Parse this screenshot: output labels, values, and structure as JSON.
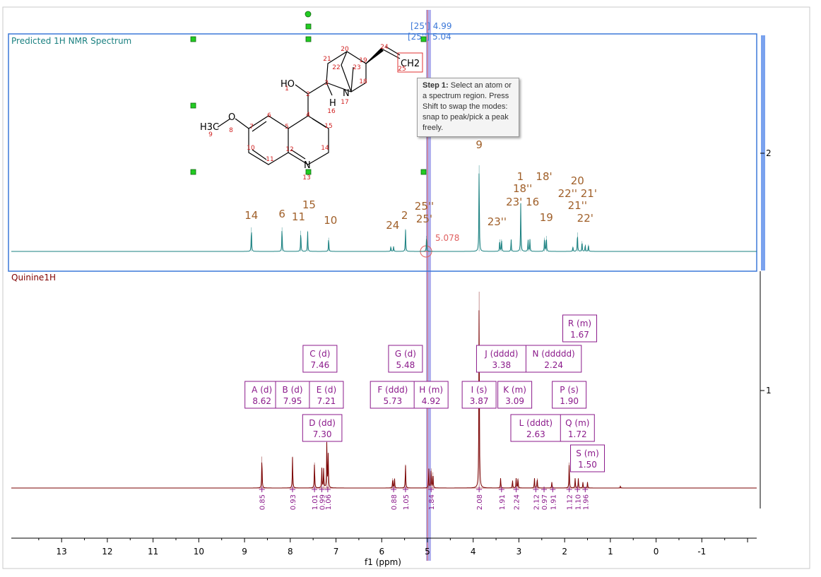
{
  "colors": {
    "predicted": "#1a8080",
    "experimental": "#7a0000",
    "peak_label": "#a0602a",
    "multiplet": "#8b1a8b",
    "selection": "#3c78d8",
    "cursor": "#e06060",
    "highlight_band": "#7070e0",
    "atom_number": "#d02020",
    "handle": "#22cc22"
  },
  "labels": {
    "predicted_title": "Predicted 1H NMR Spectrum",
    "experimental_title": "Quinine1H",
    "cursor_value": "5.078",
    "shift_label_1": "[25'] 4.99",
    "shift_label_2": "[25''] 5.04"
  },
  "tooltip": {
    "step": "Step 1:",
    "text": "Select an atom or a spectrum region. Press Shift to swap the modes: snap to peak/pick a peak freely."
  },
  "molecule": {
    "groups": [
      "HO",
      "H",
      "N",
      "N",
      "H3C",
      "O",
      "CH2"
    ],
    "atom_numbers": [
      "1",
      "2",
      "3",
      "4",
      "5",
      "6",
      "7",
      "8",
      "9",
      "10",
      "11",
      "12",
      "13",
      "14",
      "15",
      "16",
      "17",
      "18",
      "19",
      "20",
      "21",
      "22",
      "23",
      "24",
      "25"
    ]
  },
  "chart_data": {
    "type": "line",
    "xlabel": "f1 (ppm)",
    "xlim": [
      14.1,
      -2.2
    ],
    "x_reversed": true,
    "xticks": [
      13,
      12,
      11,
      10,
      9,
      8,
      7,
      6,
      5,
      4,
      3,
      2,
      1,
      0,
      -1
    ],
    "right_ticks": [
      "2",
      "1"
    ],
    "series": [
      {
        "name": "Predicted 1H NMR Spectrum",
        "peaks": [
          {
            "ppm": 8.85,
            "h": 0.28
          },
          {
            "ppm": 8.18,
            "h": 0.28
          },
          {
            "ppm": 7.77,
            "h": 0.24
          },
          {
            "ppm": 7.62,
            "h": 0.24
          },
          {
            "ppm": 7.16,
            "h": 0.16
          },
          {
            "ppm": 5.8,
            "h": 0.06
          },
          {
            "ppm": 5.74,
            "h": 0.06
          },
          {
            "ppm": 5.48,
            "h": 0.26
          },
          {
            "ppm": 5.02,
            "h": 0.18
          },
          {
            "ppm": 3.87,
            "h": 1.0
          },
          {
            "ppm": 3.42,
            "h": 0.14
          },
          {
            "ppm": 3.38,
            "h": 0.14
          },
          {
            "ppm": 3.17,
            "h": 0.14
          },
          {
            "ppm": 2.96,
            "h": 0.56
          },
          {
            "ppm": 2.8,
            "h": 0.14
          },
          {
            "ppm": 2.76,
            "h": 0.14
          },
          {
            "ppm": 2.44,
            "h": 0.16
          },
          {
            "ppm": 2.4,
            "h": 0.18
          },
          {
            "ppm": 1.82,
            "h": 0.06
          },
          {
            "ppm": 1.72,
            "h": 0.22
          },
          {
            "ppm": 1.62,
            "h": 0.12
          },
          {
            "ppm": 1.55,
            "h": 0.08
          },
          {
            "ppm": 1.48,
            "h": 0.08
          }
        ],
        "assignments": [
          {
            "ppm": 8.85,
            "lines": [
              "14"
            ]
          },
          {
            "ppm": 8.18,
            "lines": [
              "6"
            ]
          },
          {
            "ppm": 7.8,
            "lines": [
              "11"
            ]
          },
          {
            "ppm": 7.62,
            "lines": [
              "15"
            ]
          },
          {
            "ppm": 7.12,
            "lines": [
              "10"
            ]
          },
          {
            "ppm": 5.76,
            "lines": [
              "24"
            ]
          },
          {
            "ppm": 5.5,
            "lines": [
              "2"
            ]
          },
          {
            "ppm": 5.04,
            "lines": [
              "25''",
              "25'"
            ]
          },
          {
            "ppm": 3.87,
            "lines": [
              "9"
            ]
          },
          {
            "ppm": 3.48,
            "lines": [
              "23''"
            ]
          },
          {
            "ppm": 2.92,
            "lines": [
              "1",
              "18''",
              "23' 16"
            ]
          },
          {
            "ppm": 2.45,
            "lines": [
              "18'"
            ]
          },
          {
            "ppm": 2.42,
            "lines": [
              "19"
            ]
          },
          {
            "ppm": 1.72,
            "lines": [
              "20",
              "22'' 21'",
              "21''",
              "22'"
            ]
          }
        ]
      },
      {
        "name": "Quinine1H",
        "peaks": [
          {
            "ppm": 8.62,
            "h": 0.16
          },
          {
            "ppm": 7.95,
            "h": 0.16
          },
          {
            "ppm": 7.47,
            "h": 0.13
          },
          {
            "ppm": 7.31,
            "h": 0.1
          },
          {
            "ppm": 7.27,
            "h": 0.1
          },
          {
            "ppm": 7.2,
            "h": 0.24
          },
          {
            "ppm": 7.17,
            "h": 0.17
          },
          {
            "ppm": 5.76,
            "h": 0.05
          },
          {
            "ppm": 5.72,
            "h": 0.05
          },
          {
            "ppm": 5.48,
            "h": 0.12
          },
          {
            "ppm": 4.97,
            "h": 0.1
          },
          {
            "ppm": 4.92,
            "h": 0.1
          },
          {
            "ppm": 4.88,
            "h": 0.08
          },
          {
            "ppm": 3.87,
            "h": 1.0
          },
          {
            "ppm": 3.4,
            "h": 0.05
          },
          {
            "ppm": 3.14,
            "h": 0.04
          },
          {
            "ppm": 3.06,
            "h": 0.05
          },
          {
            "ppm": 3.02,
            "h": 0.05
          },
          {
            "ppm": 2.66,
            "h": 0.05
          },
          {
            "ppm": 2.6,
            "h": 0.05
          },
          {
            "ppm": 2.28,
            "h": 0.03
          },
          {
            "ppm": 1.9,
            "h": 0.13
          },
          {
            "ppm": 1.77,
            "h": 0.05
          },
          {
            "ppm": 1.7,
            "h": 0.05
          },
          {
            "ppm": 1.6,
            "h": 0.03
          },
          {
            "ppm": 1.5,
            "h": 0.03
          },
          {
            "ppm": 0.78,
            "h": 0.01
          }
        ],
        "multiplets": [
          {
            "label": "A (d)",
            "value": "8.62",
            "ppm": 8.62,
            "row": 2
          },
          {
            "label": "B (d)",
            "value": "7.95",
            "ppm": 7.95,
            "row": 2
          },
          {
            "label": "C (d)",
            "value": "7.46",
            "ppm": 7.35,
            "row": 1
          },
          {
            "label": "E (d)",
            "value": "7.21",
            "ppm": 7.21,
            "row": 2
          },
          {
            "label": "D (dd)",
            "value": "7.30",
            "ppm": 7.3,
            "row": 3
          },
          {
            "label": "G (d)",
            "value": "5.48",
            "ppm": 5.48,
            "row": 1
          },
          {
            "label": "F (ddd)",
            "value": "5.73",
            "ppm": 5.76,
            "row": 2
          },
          {
            "label": "H (m)",
            "value": "4.92",
            "ppm": 4.92,
            "row": 2
          },
          {
            "label": "I (s)",
            "value": "3.87",
            "ppm": 3.87,
            "row": 2
          },
          {
            "label": "J (dddd)",
            "value": "3.38",
            "ppm": 3.38,
            "row": 1
          },
          {
            "label": "K (m)",
            "value": "3.09",
            "ppm": 3.09,
            "row": 2
          },
          {
            "label": "L (dddt)",
            "value": "2.63",
            "ppm": 2.63,
            "row": 3
          },
          {
            "label": "N (ddddd)",
            "value": "2.24",
            "ppm": 2.24,
            "row": 1
          },
          {
            "label": "P (s)",
            "value": "1.90",
            "ppm": 1.9,
            "row": 2
          },
          {
            "label": "R (m)",
            "value": "1.67",
            "ppm": 1.67,
            "row": 0
          },
          {
            "label": "Q (m)",
            "value": "1.72",
            "ppm": 1.72,
            "row": 3
          },
          {
            "label": "S (m)",
            "value": "1.50",
            "ppm": 1.5,
            "row": 4
          }
        ],
        "integrals": [
          {
            "ppm": 8.62,
            "label": "0.85"
          },
          {
            "ppm": 7.95,
            "label": "0.93"
          },
          {
            "ppm": 7.47,
            "label": "1.01"
          },
          {
            "ppm": 7.31,
            "label": "0.99"
          },
          {
            "ppm": 7.18,
            "label": "1.06"
          },
          {
            "ppm": 5.74,
            "label": "0.88"
          },
          {
            "ppm": 5.48,
            "label": "1.05"
          },
          {
            "ppm": 4.92,
            "label": "1.84"
          },
          {
            "ppm": 3.87,
            "label": "2.08"
          },
          {
            "ppm": 3.38,
            "label": "1.91"
          },
          {
            "ppm": 3.06,
            "label": "2.24"
          },
          {
            "ppm": 2.63,
            "label": "2.12"
          },
          {
            "ppm": 2.45,
            "label": "0.97"
          },
          {
            "ppm": 2.26,
            "label": "1.91"
          },
          {
            "ppm": 1.9,
            "label": "1.12"
          },
          {
            "ppm": 1.72,
            "label": "1.10"
          },
          {
            "ppm": 1.55,
            "label": "1.96"
          }
        ]
      }
    ]
  }
}
